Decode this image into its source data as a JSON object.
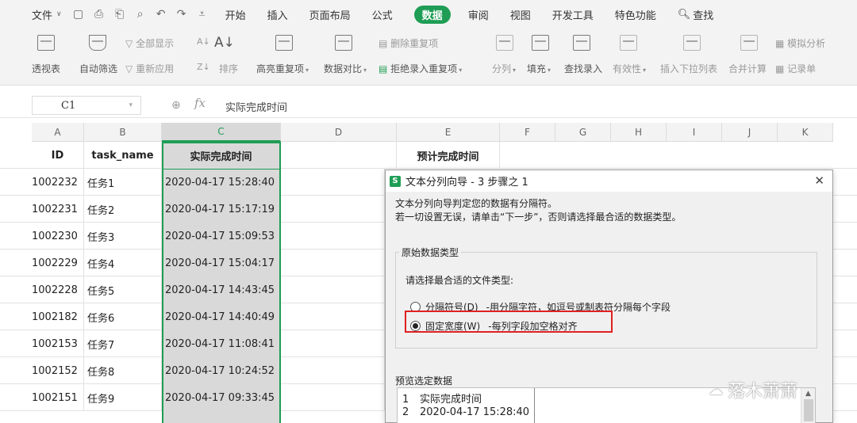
{
  "menubar": {
    "file_label": "文件",
    "tabs": [
      "开始",
      "插入",
      "页面布局",
      "公式",
      "数据",
      "审阅",
      "视图",
      "开发工具",
      "特色功能"
    ],
    "active_tab": "数据",
    "search_label": "查找"
  },
  "ribbon": {
    "pivot_label": "透视表",
    "autofilter_label": "自动筛选",
    "show_all_label": "全部显示",
    "reapply_label": "重新应用",
    "sort_label": "排序",
    "highlight_dup_label": "高亮重复项",
    "delete_dup_label": "删除重复项",
    "reject_dup_label": "拒绝录入重复项",
    "data_compare_label": "数据对比",
    "split_label": "分列",
    "fill_label": "填充",
    "lookup_label": "查找录入",
    "validity_label": "有效性",
    "insert_dropdown_label": "插入下拉列表",
    "consolidate_label": "合并计算",
    "simulate_label": "模拟分析",
    "record_label": "记录单"
  },
  "formula_bar": {
    "cell_ref": "C1",
    "fx": "fx",
    "content": "实际完成时间"
  },
  "grid": {
    "columns": [
      "A",
      "B",
      "C",
      "D",
      "E",
      "F",
      "G",
      "H",
      "I",
      "J",
      "K"
    ],
    "selected_column": "C",
    "header_row": {
      "id": "ID",
      "task_name": "task_name",
      "actual": "实际完成时间",
      "planned": "预计完成时间"
    },
    "rows": [
      {
        "id": "1002232",
        "task": "任务1",
        "time": "2020-04-17 15:28:40"
      },
      {
        "id": "1002231",
        "task": "任务2",
        "time": "2020-04-17 15:17:19"
      },
      {
        "id": "1002230",
        "task": "任务3",
        "time": "2020-04-17 15:09:53"
      },
      {
        "id": "1002229",
        "task": "任务4",
        "time": "2020-04-17 15:04:17"
      },
      {
        "id": "1002228",
        "task": "任务5",
        "time": "2020-04-17 14:43:45"
      },
      {
        "id": "1002182",
        "task": "任务6",
        "time": "2020-04-17 14:40:49"
      },
      {
        "id": "1002153",
        "task": "任务7",
        "time": "2020-04-17 11:08:41"
      },
      {
        "id": "1002152",
        "task": "任务8",
        "time": "2020-04-17 10:24:52"
      },
      {
        "id": "1002151",
        "task": "任务9",
        "time": "2020-04-17 09:33:45"
      }
    ]
  },
  "dialog": {
    "title": "文本分列向导 - 3 步骤之 1",
    "intro_line1": "文本分列向导判定您的数据有分隔符。",
    "intro_line2": "若一切设置无误，请单击“下一步”，否则请选择最合适的数据类型。",
    "group_label": "原始数据类型",
    "question": "请选择最合适的文件类型:",
    "option_delimited": "分隔符号(D)",
    "option_delimited_desc": "-用分隔字符，如逗号或制表符分隔每个字段",
    "option_fixed": "固定宽度(W)",
    "option_fixed_desc": "-每列字段加空格对齐",
    "selected_option": "固定宽度(W)",
    "preview_label": "预览选定数据",
    "preview_rows": [
      {
        "n": "1",
        "text": "实际完成时间"
      },
      {
        "n": "2",
        "text": "2020-04-17 15:28:40"
      }
    ],
    "highlight_color": "#e02020"
  },
  "watermark": {
    "text": "落木萧萧"
  },
  "colors": {
    "accent": "#1f9d55",
    "selection_fill": "#d9d9d9"
  }
}
